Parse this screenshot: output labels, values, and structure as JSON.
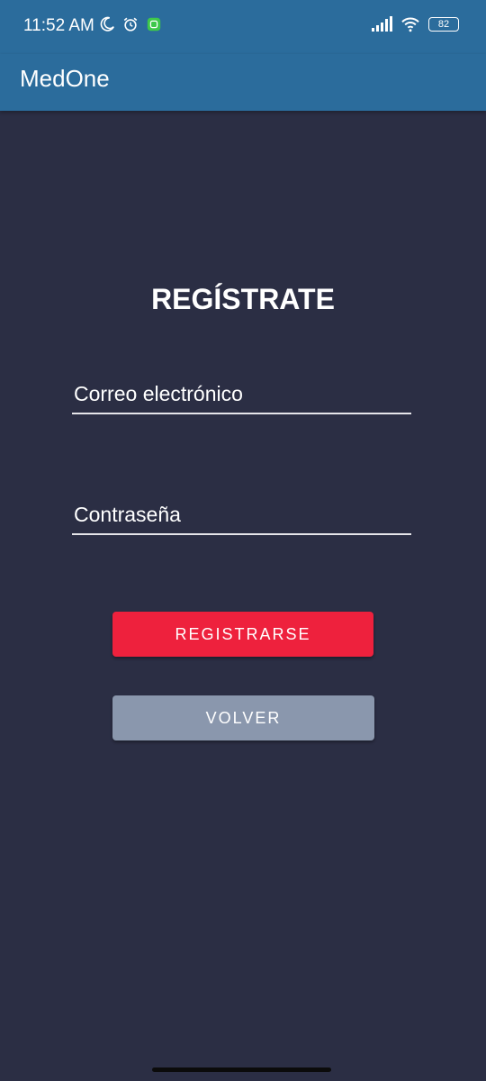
{
  "status_bar": {
    "time": "11:52 AM",
    "icons_left": [
      "moon-icon",
      "alarm-icon",
      "app-notification-icon"
    ],
    "icons_right": [
      "signal-icon",
      "wifi-icon",
      "battery-icon"
    ],
    "battery_level": "82"
  },
  "app_bar": {
    "title": "MedOne",
    "color": "#2b6c9c"
  },
  "form": {
    "title": "REGÍSTRATE",
    "email_placeholder": "Correo electrónico",
    "password_placeholder": "Contraseña",
    "register_label": "REGISTRARSE",
    "back_label": "VOLVER"
  },
  "colors": {
    "background": "#2b2e44",
    "register_button": "#ee213d",
    "back_button": "#8a97ad"
  }
}
